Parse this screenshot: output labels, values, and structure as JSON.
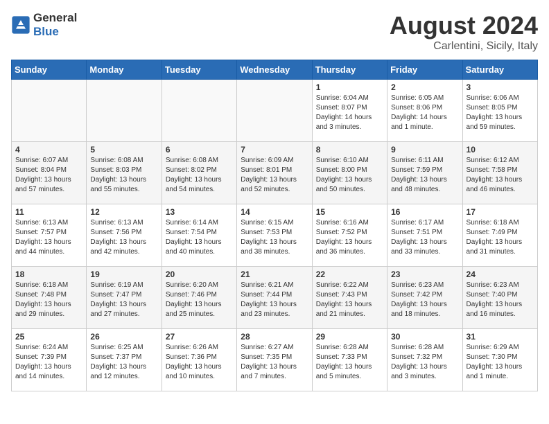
{
  "header": {
    "logo": {
      "general": "General",
      "blue": "Blue"
    },
    "title": "August 2024",
    "location": "Carlentini, Sicily, Italy"
  },
  "weekdays": [
    "Sunday",
    "Monday",
    "Tuesday",
    "Wednesday",
    "Thursday",
    "Friday",
    "Saturday"
  ],
  "weeks": [
    [
      {
        "day": "",
        "info": ""
      },
      {
        "day": "",
        "info": ""
      },
      {
        "day": "",
        "info": ""
      },
      {
        "day": "",
        "info": ""
      },
      {
        "day": "1",
        "info": "Sunrise: 6:04 AM\nSunset: 8:07 PM\nDaylight: 14 hours\nand 3 minutes."
      },
      {
        "day": "2",
        "info": "Sunrise: 6:05 AM\nSunset: 8:06 PM\nDaylight: 14 hours\nand 1 minute."
      },
      {
        "day": "3",
        "info": "Sunrise: 6:06 AM\nSunset: 8:05 PM\nDaylight: 13 hours\nand 59 minutes."
      }
    ],
    [
      {
        "day": "4",
        "info": "Sunrise: 6:07 AM\nSunset: 8:04 PM\nDaylight: 13 hours\nand 57 minutes."
      },
      {
        "day": "5",
        "info": "Sunrise: 6:08 AM\nSunset: 8:03 PM\nDaylight: 13 hours\nand 55 minutes."
      },
      {
        "day": "6",
        "info": "Sunrise: 6:08 AM\nSunset: 8:02 PM\nDaylight: 13 hours\nand 54 minutes."
      },
      {
        "day": "7",
        "info": "Sunrise: 6:09 AM\nSunset: 8:01 PM\nDaylight: 13 hours\nand 52 minutes."
      },
      {
        "day": "8",
        "info": "Sunrise: 6:10 AM\nSunset: 8:00 PM\nDaylight: 13 hours\nand 50 minutes."
      },
      {
        "day": "9",
        "info": "Sunrise: 6:11 AM\nSunset: 7:59 PM\nDaylight: 13 hours\nand 48 minutes."
      },
      {
        "day": "10",
        "info": "Sunrise: 6:12 AM\nSunset: 7:58 PM\nDaylight: 13 hours\nand 46 minutes."
      }
    ],
    [
      {
        "day": "11",
        "info": "Sunrise: 6:13 AM\nSunset: 7:57 PM\nDaylight: 13 hours\nand 44 minutes."
      },
      {
        "day": "12",
        "info": "Sunrise: 6:13 AM\nSunset: 7:56 PM\nDaylight: 13 hours\nand 42 minutes."
      },
      {
        "day": "13",
        "info": "Sunrise: 6:14 AM\nSunset: 7:54 PM\nDaylight: 13 hours\nand 40 minutes."
      },
      {
        "day": "14",
        "info": "Sunrise: 6:15 AM\nSunset: 7:53 PM\nDaylight: 13 hours\nand 38 minutes."
      },
      {
        "day": "15",
        "info": "Sunrise: 6:16 AM\nSunset: 7:52 PM\nDaylight: 13 hours\nand 36 minutes."
      },
      {
        "day": "16",
        "info": "Sunrise: 6:17 AM\nSunset: 7:51 PM\nDaylight: 13 hours\nand 33 minutes."
      },
      {
        "day": "17",
        "info": "Sunrise: 6:18 AM\nSunset: 7:49 PM\nDaylight: 13 hours\nand 31 minutes."
      }
    ],
    [
      {
        "day": "18",
        "info": "Sunrise: 6:18 AM\nSunset: 7:48 PM\nDaylight: 13 hours\nand 29 minutes."
      },
      {
        "day": "19",
        "info": "Sunrise: 6:19 AM\nSunset: 7:47 PM\nDaylight: 13 hours\nand 27 minutes."
      },
      {
        "day": "20",
        "info": "Sunrise: 6:20 AM\nSunset: 7:46 PM\nDaylight: 13 hours\nand 25 minutes."
      },
      {
        "day": "21",
        "info": "Sunrise: 6:21 AM\nSunset: 7:44 PM\nDaylight: 13 hours\nand 23 minutes."
      },
      {
        "day": "22",
        "info": "Sunrise: 6:22 AM\nSunset: 7:43 PM\nDaylight: 13 hours\nand 21 minutes."
      },
      {
        "day": "23",
        "info": "Sunrise: 6:23 AM\nSunset: 7:42 PM\nDaylight: 13 hours\nand 18 minutes."
      },
      {
        "day": "24",
        "info": "Sunrise: 6:23 AM\nSunset: 7:40 PM\nDaylight: 13 hours\nand 16 minutes."
      }
    ],
    [
      {
        "day": "25",
        "info": "Sunrise: 6:24 AM\nSunset: 7:39 PM\nDaylight: 13 hours\nand 14 minutes."
      },
      {
        "day": "26",
        "info": "Sunrise: 6:25 AM\nSunset: 7:37 PM\nDaylight: 13 hours\nand 12 minutes."
      },
      {
        "day": "27",
        "info": "Sunrise: 6:26 AM\nSunset: 7:36 PM\nDaylight: 13 hours\nand 10 minutes."
      },
      {
        "day": "28",
        "info": "Sunrise: 6:27 AM\nSunset: 7:35 PM\nDaylight: 13 hours\nand 7 minutes."
      },
      {
        "day": "29",
        "info": "Sunrise: 6:28 AM\nSunset: 7:33 PM\nDaylight: 13 hours\nand 5 minutes."
      },
      {
        "day": "30",
        "info": "Sunrise: 6:28 AM\nSunset: 7:32 PM\nDaylight: 13 hours\nand 3 minutes."
      },
      {
        "day": "31",
        "info": "Sunrise: 6:29 AM\nSunset: 7:30 PM\nDaylight: 13 hours\nand 1 minute."
      }
    ]
  ]
}
